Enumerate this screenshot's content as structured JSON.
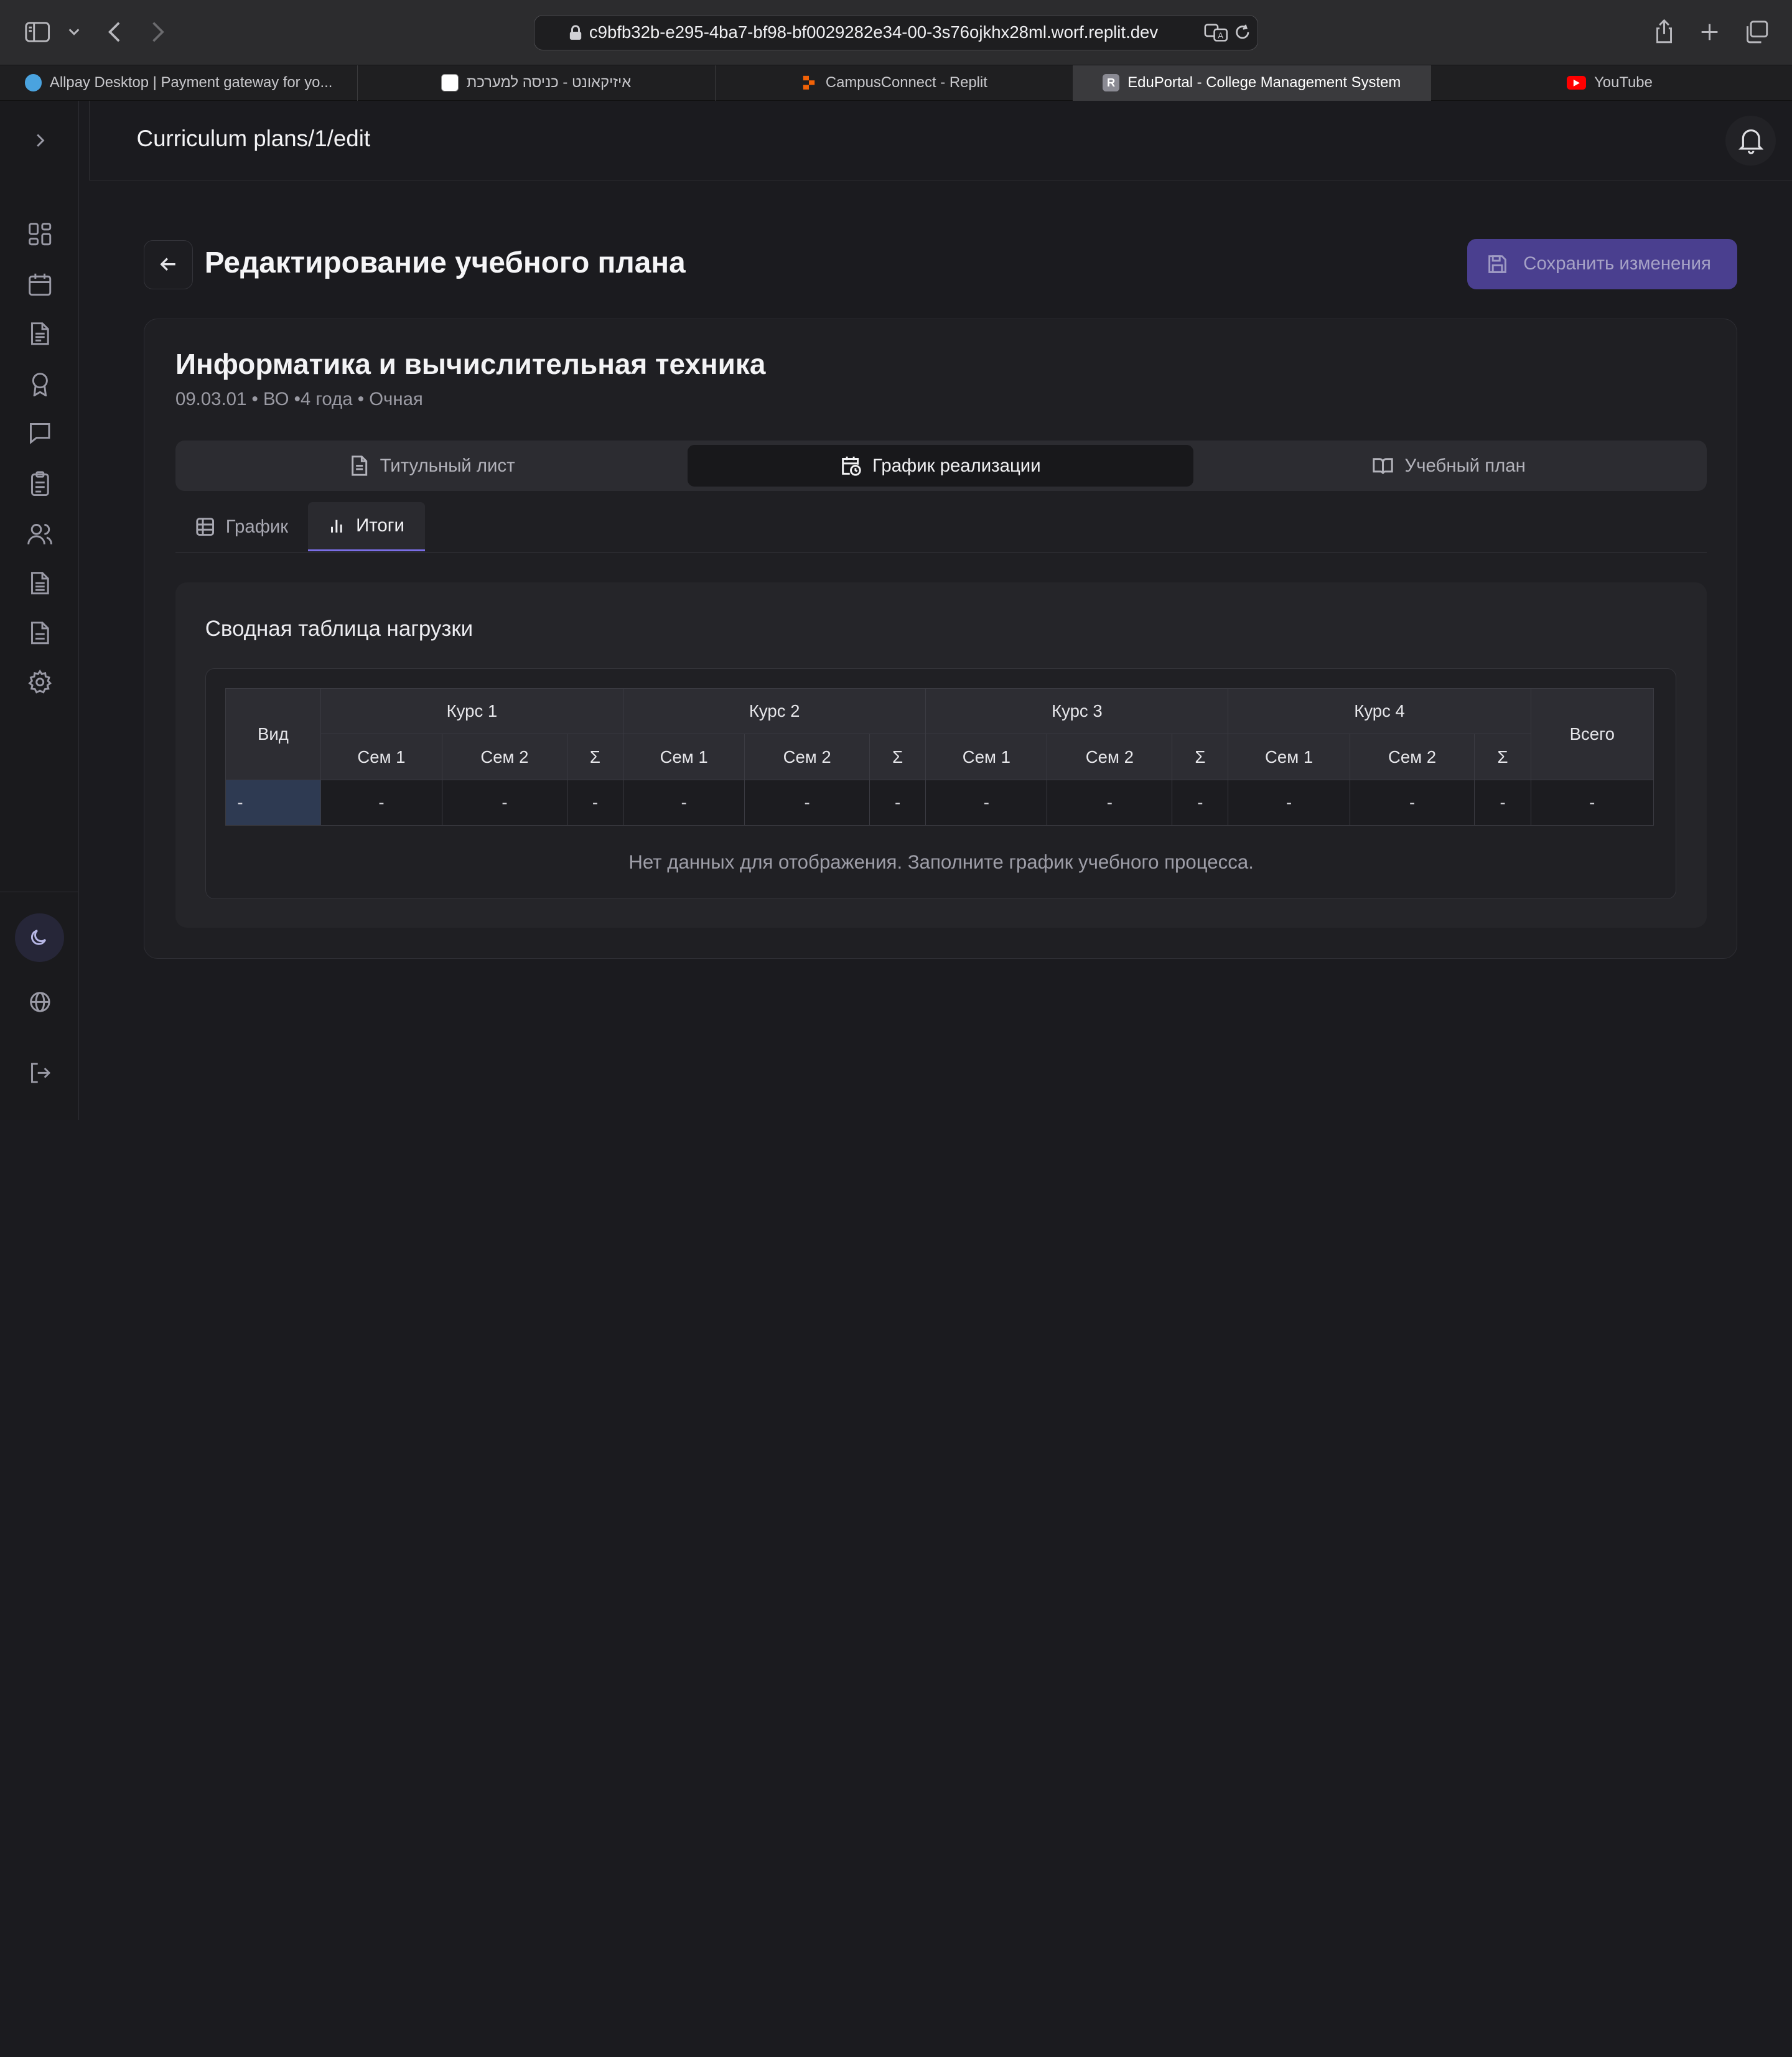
{
  "browser": {
    "url": "c9bfb32b-e295-4ba7-bf98-bf0029282e34-00-3s76ojkhx28ml.worf.replit.dev",
    "tabs": [
      {
        "title": "Allpay Desktop | Payment gateway for yo...",
        "favicon_color": "#4aa3df",
        "active": false
      },
      {
        "title": "איזיקאונט - כניסה למערכת",
        "favicon_color": "#ffffff",
        "active": false
      },
      {
        "title": "CampusConnect - Replit",
        "favicon_color": "#f26207",
        "active": false
      },
      {
        "title": "EduPortal - College Management System",
        "favicon_letter": "R",
        "favicon_color": "#8a8a93",
        "active": true
      },
      {
        "title": "YouTube",
        "favicon_color": "#ff0000",
        "active": false
      }
    ]
  },
  "header": {
    "breadcrumb": "Curriculum plans/1/edit"
  },
  "page": {
    "title": "Редактирование учебного плана",
    "save_label": "Сохранить изменения"
  },
  "program": {
    "name": "Информатика и вычислительная техника",
    "meta": "09.03.01 • ВО •4 года • Очная"
  },
  "main_tabs": [
    {
      "label": "Титульный лист",
      "icon": "file-text-icon",
      "active": false
    },
    {
      "label": "График реализации",
      "icon": "calendar-clock-icon",
      "active": true
    },
    {
      "label": "Учебный план",
      "icon": "book-open-icon",
      "active": false
    }
  ],
  "sub_tabs": [
    {
      "label": "График",
      "icon": "table-icon",
      "active": false
    },
    {
      "label": "Итоги",
      "icon": "bar-chart-icon",
      "active": true
    }
  ],
  "summary": {
    "title": "Сводная таблица нагрузки",
    "col_kind": "Вид",
    "courses": [
      "Курс 1",
      "Курс 2",
      "Курс 3",
      "Курс 4"
    ],
    "sem1": "Сем 1",
    "sem2": "Сем 2",
    "sigma": "Σ",
    "total": "Всего",
    "row": [
      "-",
      "-",
      "-",
      "-",
      "-",
      "-",
      "-",
      "-",
      "-",
      "-",
      "-",
      "-",
      "-",
      "-"
    ],
    "empty_message": "Нет данных для отображения. Заполните график учебного процесса."
  },
  "colors": {
    "accent": "#4a3f8f",
    "active_tab_underline": "#7a6ee6",
    "background": "#1b1b1f"
  }
}
